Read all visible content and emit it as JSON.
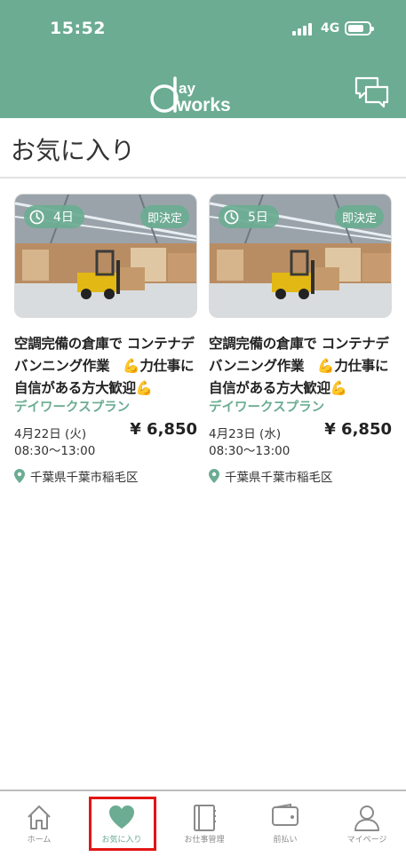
{
  "status_bar": {
    "time": "15:52",
    "network": "4G"
  },
  "header": {
    "logo_text": "dayworks",
    "chat_icon": "chat-bubbles-icon"
  },
  "page": {
    "title": "お気に入り"
  },
  "colors": {
    "brand": "#6bac93",
    "price": "#222222",
    "highlight": "#e31515"
  },
  "cards": [
    {
      "days": "4日",
      "instant": "即決定",
      "title": "空調完備の倉庫で コンテナデバンニング作業　💪力仕事に自信がある方大歓迎💪",
      "plan": "デイワークスプラン",
      "date": "4月22日 (火)",
      "price": "¥ 6,850",
      "hours": "08:30〜13:00",
      "location": "千葉県千葉市稲毛区"
    },
    {
      "days": "5日",
      "instant": "即決定",
      "title": "空調完備の倉庫で コンテナデバンニング作業　💪力仕事に自信がある方大歓迎💪",
      "plan": "デイワークスプラン",
      "date": "4月23日 (水)",
      "price": "¥ 6,850",
      "hours": "08:30〜13:00",
      "location": "千葉県千葉市稲毛区"
    }
  ],
  "tabbar": {
    "items": [
      {
        "label": "ホーム",
        "icon": "home-icon",
        "active": false
      },
      {
        "label": "お気に入り",
        "icon": "heart-icon",
        "active": true
      },
      {
        "label": "お仕事管理",
        "icon": "notebook-icon",
        "active": false
      },
      {
        "label": "前払い",
        "icon": "wallet-icon",
        "active": false
      },
      {
        "label": "マイページ",
        "icon": "person-icon",
        "active": false
      }
    ]
  }
}
